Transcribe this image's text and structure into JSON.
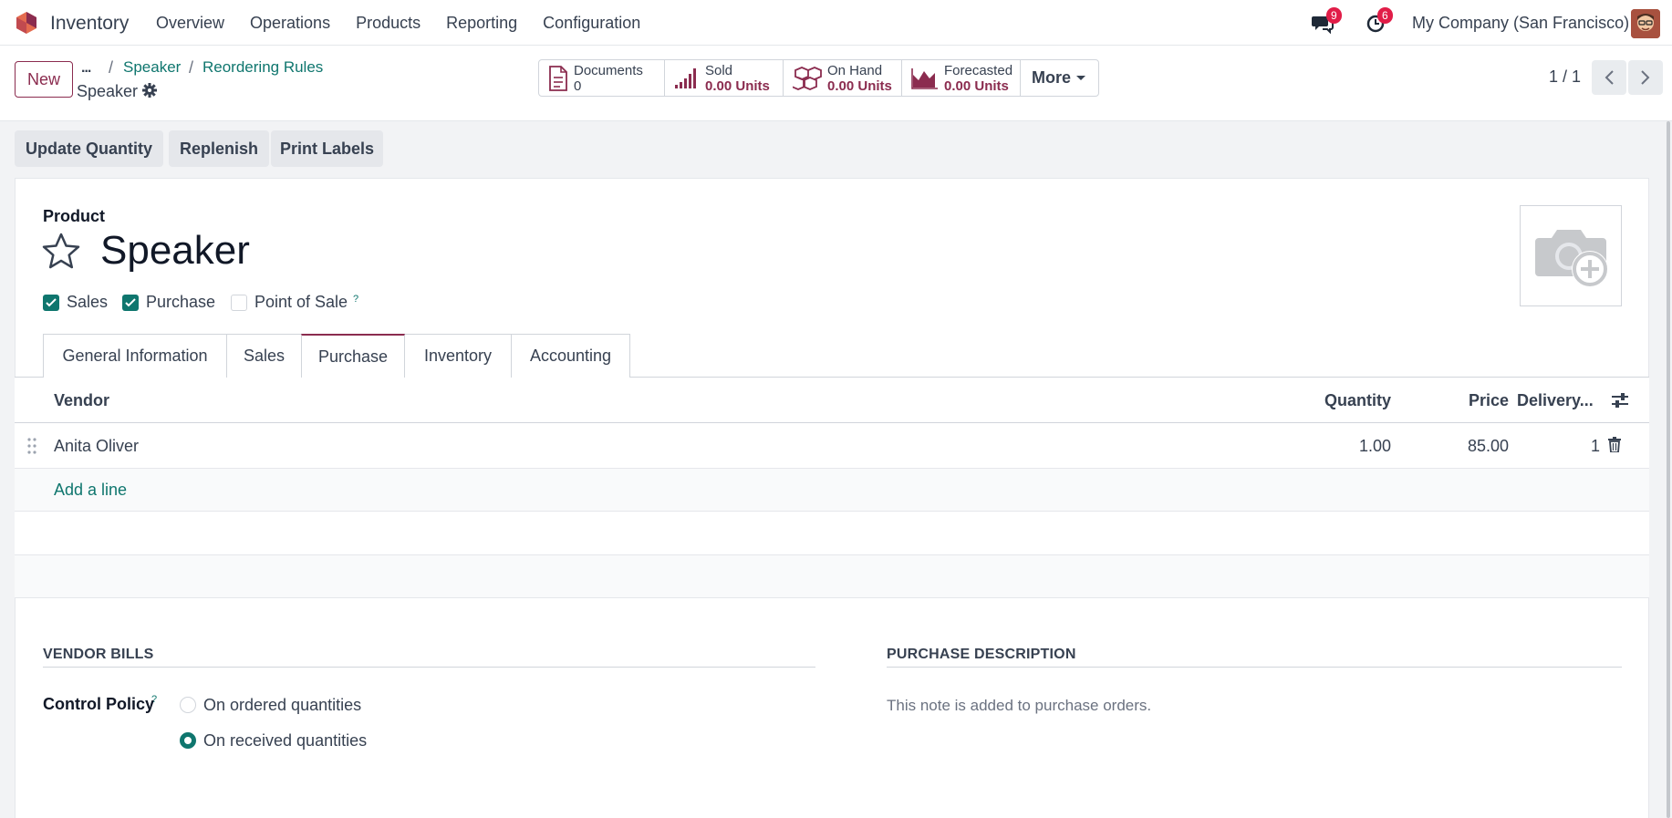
{
  "navbar": {
    "app_name": "Inventory",
    "menu": [
      "Overview",
      "Operations",
      "Products",
      "Reporting",
      "Configuration"
    ],
    "messages_count": "9",
    "activities_count": "6",
    "company": "My Company (San Francisco)"
  },
  "control_panel": {
    "new_label": "New",
    "breadcrumb_dots": "...",
    "breadcrumb": [
      "Speaker",
      "Reordering Rules"
    ],
    "current": "Speaker",
    "smart_buttons": [
      {
        "label": "Documents",
        "value": "0",
        "icon": "document-icon"
      },
      {
        "label": "Sold",
        "value": "0.00 Units",
        "icon": "bar-chart-icon"
      },
      {
        "label": "On Hand",
        "value": "0.00 Units",
        "icon": "cubes-icon"
      },
      {
        "label": "Forecasted",
        "value": "0.00 Units",
        "icon": "area-chart-icon"
      }
    ],
    "more_label": "More",
    "pager": "1 / 1"
  },
  "actions": [
    "Update Quantity",
    "Replenish",
    "Print Labels"
  ],
  "form": {
    "product_label": "Product",
    "name": "Speaker",
    "checkboxes": [
      {
        "label": "Sales",
        "checked": true
      },
      {
        "label": "Purchase",
        "checked": true
      },
      {
        "label": "Point of Sale",
        "checked": false
      }
    ],
    "help_mark": "?",
    "tabs": [
      "General Information",
      "Sales",
      "Purchase",
      "Inventory",
      "Accounting"
    ],
    "active_tab": "Purchase"
  },
  "vendors_table": {
    "headers": {
      "vendor": "Vendor",
      "quantity": "Quantity",
      "price": "Price",
      "delivery": "Delivery..."
    },
    "rows": [
      {
        "vendor": "Anita Oliver",
        "quantity": "1.00",
        "price": "85.00",
        "delivery": "1"
      }
    ],
    "add_line": "Add a line"
  },
  "vendor_bills": {
    "title": "VENDOR BILLS",
    "control_policy_label": "Control Policy",
    "options": [
      {
        "label": "On ordered quantities",
        "selected": false
      },
      {
        "label": "On received quantities",
        "selected": true
      }
    ]
  },
  "purchase_description": {
    "title": "PURCHASE DESCRIPTION",
    "placeholder": "This note is added to purchase orders."
  },
  "colors": {
    "brand": "#8b2c4f",
    "accent": "#0f766e",
    "badge": "#e11d48"
  }
}
